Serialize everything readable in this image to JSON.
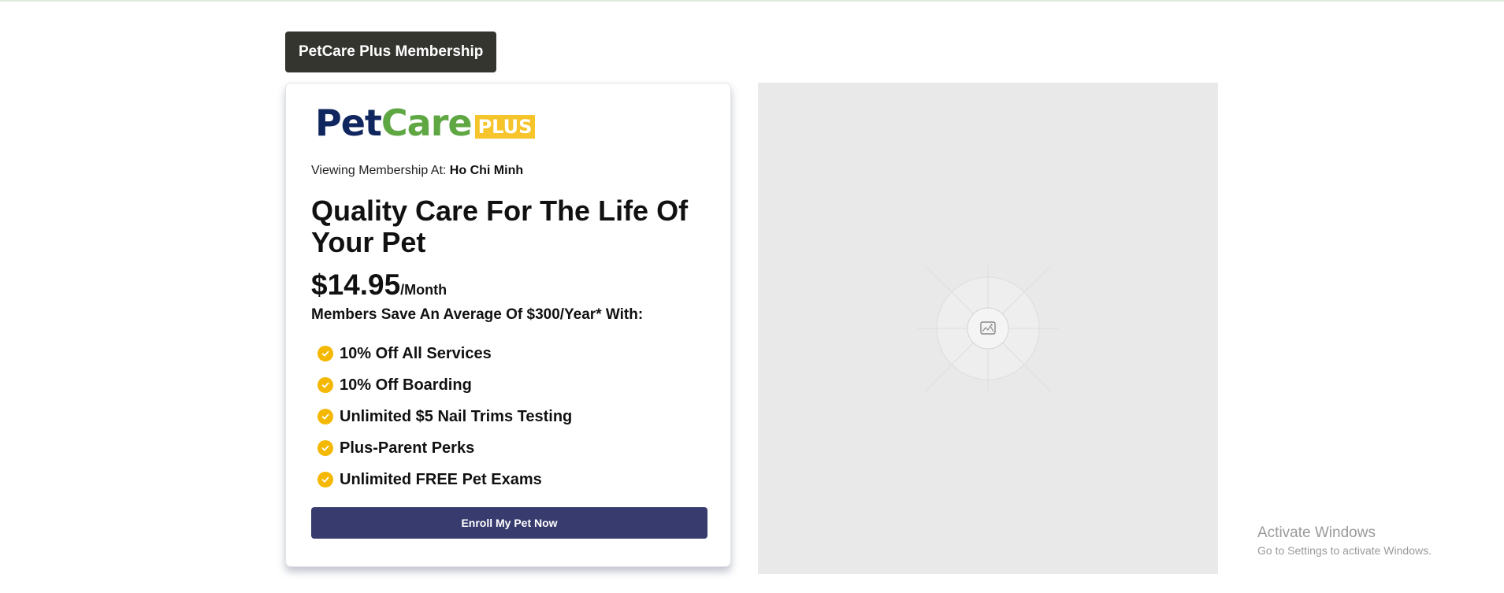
{
  "page": {
    "tab_label": "PetCare Plus Membership"
  },
  "logo": {
    "pet": "Pet",
    "care": "Care",
    "plus": "PLUS"
  },
  "viewing": {
    "label": "Viewing Membership At:",
    "location": "Ho Chi Minh"
  },
  "headline": "Quality Care For The Life Of Your Pet",
  "pricing": {
    "price": "$14.95",
    "period": "/Month"
  },
  "savings_text": "Members Save An Average Of $300/Year* With:",
  "perks": [
    "10% Off All Services",
    "10% Off Boarding",
    "Unlimited $5 Nail Trims Testing",
    "Plus-Parent Perks",
    "Unlimited FREE Pet Exams"
  ],
  "cta": {
    "label": "Enroll My Pet Now"
  },
  "watermark": {
    "title": "Activate Windows",
    "subtitle": "Go to Settings to activate Windows."
  },
  "colors": {
    "tab_bg": "#34352f",
    "logo_navy": "#10265e",
    "logo_green": "#5ea742",
    "logo_yellow": "#f6c52b",
    "check_yellow": "#f5b800",
    "button_bg": "#383b6e"
  },
  "icons": {
    "perk": "check-circle-icon",
    "placeholder": "image-icon"
  }
}
